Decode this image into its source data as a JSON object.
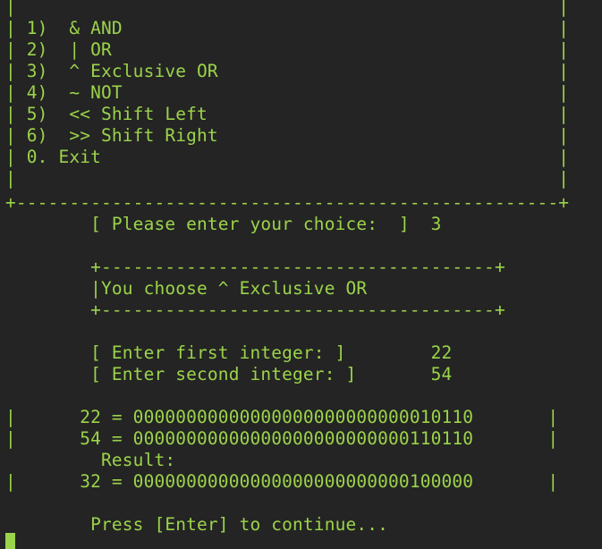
{
  "theme": {
    "background": "#242424",
    "foreground": "#9bd34a"
  },
  "terminal": {
    "lines": [
      "|                                                   |",
      "| 1)  & AND                                         |",
      "| 2)  | OR                                          |",
      "| 3)  ^ Exclusive OR                                |",
      "| 4)  ~ NOT                                         |",
      "| 5)  << Shift Left                                 |",
      "| 6)  >> Shift Right                                |",
      "| 0. Exit                                           |",
      "|                                                   |",
      "+---------------------------------------------------+",
      "        [ Please enter your choice:  ]  3",
      "",
      "        +-------------------------------------+",
      "        |You choose ^ Exclusive OR",
      "        +-------------------------------------+",
      "",
      "        [ Enter first integer: ]        22",
      "        [ Enter second integer: ]       54",
      "",
      "|      22 = 00000000000000000000000000010110       |",
      "|      54 = 00000000000000000000000000110110       |",
      "         Result:",
      "|      32 = 00000000000000000000000000100000       |",
      "",
      "        Press [Enter] to continue..."
    ]
  }
}
